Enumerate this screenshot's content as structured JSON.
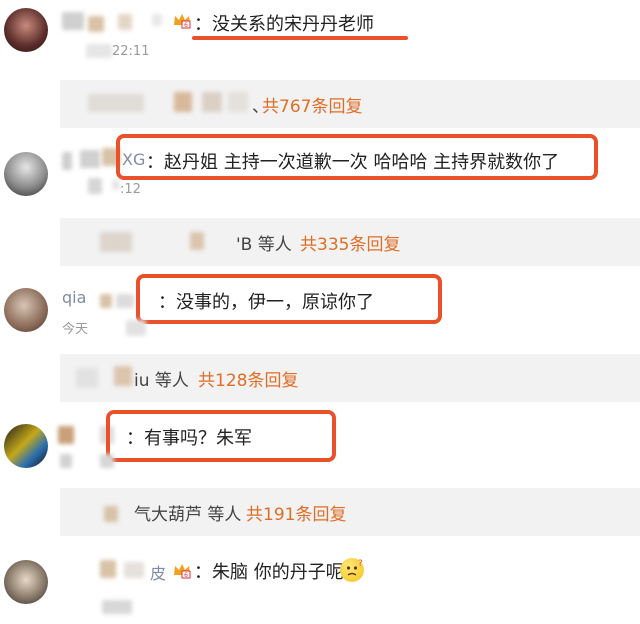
{
  "comments": [
    {
      "name_fragment": "",
      "text": "：没关系的宋丹丹老师",
      "time": "22:11"
    },
    {
      "name_fragment": "XG",
      "text": "：赵丹姐  主持一次道歉一次   哈哈哈   主持界就数你了",
      "time": ":12"
    },
    {
      "name_fragment": "qia",
      "text": "：没事的，伊一，原谅你了",
      "time": "今天"
    },
    {
      "name_fragment": "",
      "text": "：有事吗？朱军",
      "time": ""
    },
    {
      "name_fragment": "皮",
      "text": "：朱脑 你的丹子呢",
      "time": ""
    }
  ],
  "replies": [
    {
      "users": "、",
      "count": "共767条回复"
    },
    {
      "users": "'B 等人",
      "count": "共335条回复"
    },
    {
      "users": "iu 等人",
      "count": "共128条回复"
    },
    {
      "users": "气大葫芦 等人",
      "count": "共191条回复"
    }
  ],
  "colors": {
    "highlight": "#e8512a",
    "reply_count": "#e06d26",
    "reply_bg": "#f2f2f2"
  },
  "icons": [
    "crown-badge-icon",
    "thinking-face-emoji-icon"
  ]
}
